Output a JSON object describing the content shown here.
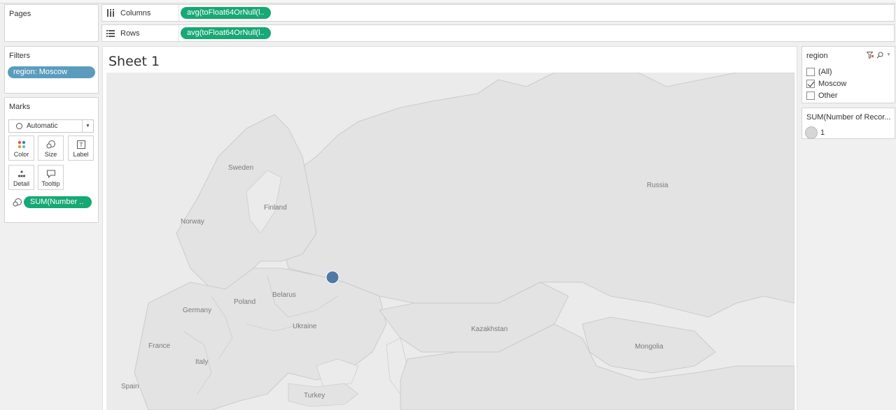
{
  "pages": {
    "title": "Pages"
  },
  "shelves": {
    "columns": {
      "label": "Columns",
      "pill": "avg(toFloat64OrNull(l.."
    },
    "rows": {
      "label": "Rows",
      "pill": "avg(toFloat64OrNull(l.."
    }
  },
  "filters": {
    "title": "Filters",
    "pill": "region: Moscow"
  },
  "marks": {
    "title": "Marks",
    "mark_type": "Automatic",
    "buttons": {
      "color": "Color",
      "size": "Size",
      "label": "Label",
      "detail": "Detail",
      "tooltip": "Tooltip"
    },
    "size_pill": "SUM(Number .."
  },
  "sheet": {
    "title": "Sheet 1",
    "map_labels": {
      "sweden": "Sweden",
      "finland": "Finland",
      "norway": "Norway",
      "russia": "Russia",
      "belarus": "Belarus",
      "poland": "Poland",
      "germany": "Germany",
      "ukraine": "Ukraine",
      "france": "France",
      "italy": "Italy",
      "spain": "Spain",
      "turkey": "Turkey",
      "kazakhstan": "Kazakhstan",
      "mongolia": "Mongolia"
    },
    "point": {
      "location": "Moscow",
      "color": "#4e79a7"
    }
  },
  "region_filter": {
    "title": "region",
    "options": [
      {
        "label": "(All)",
        "checked": false
      },
      {
        "label": "Moscow",
        "checked": true
      },
      {
        "label": "Other",
        "checked": false
      }
    ]
  },
  "size_legend": {
    "title": "SUM(Number of Recor...",
    "value": "1"
  },
  "colors": {
    "pill_green": "#16a875",
    "filter_blue": "#5b9cbd",
    "mark_blue": "#4e79a7"
  }
}
